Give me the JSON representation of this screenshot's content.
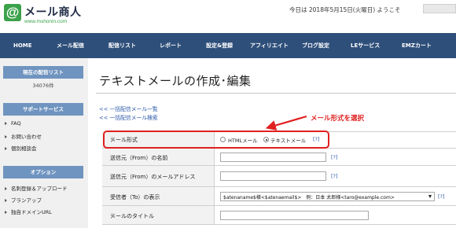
{
  "header": {
    "logo_mark": "@",
    "logo_name": "メール商人",
    "logo_url": "www.mshonin.com",
    "date_text": "今日は 2018年5月15日(火曜日) ようこそ"
  },
  "nav": {
    "items": [
      "HOME",
      "メール配信",
      "配信リスト",
      "レポート",
      "設定&登録",
      "アフィリエイト",
      "ブログ設定",
      "LEサービス",
      "EMZカート"
    ]
  },
  "sidebar": {
    "current_list_title": "現在の配信リスト",
    "current_list_count": "34076件",
    "support_title": "サポートサービス",
    "support_links": [
      "FAQ",
      "お問い合わせ",
      "個別相談会"
    ],
    "options_title": "オプション",
    "options_links": [
      "名刺登録＆アップロード",
      "プランアップ",
      "独自ドメインURL"
    ]
  },
  "main": {
    "title": "テキストメールの作成･編集",
    "links": [
      "<< 一括配信メール一覧",
      "<< 一括配信メール検索"
    ],
    "annotation": "メール形式を選択",
    "required_mark": "※",
    "help_text": "[?]",
    "form": {
      "mail_format": {
        "label": "メール形式",
        "options": [
          "HTMLメール",
          "テキストメール"
        ],
        "selected": "テキストメール"
      },
      "from_name": {
        "label": "送信元（From）の名前",
        "value": ""
      },
      "from_address": {
        "label": "送信元（From）のメールアドレス",
        "value": ""
      },
      "to_display": {
        "label": "受信者（To）の表示",
        "selected": "$atenaname$様<$atenaemail$>　例：日本 太郎様<taro@example.com>"
      },
      "subject": {
        "label": "メールのタイトル",
        "value": ""
      }
    }
  },
  "colors": {
    "nav_bg": "#2e4f7a",
    "sidebar_head_bg": "#6f94bf",
    "logo_green": "#3ba24b",
    "annotation_red": "#e02020",
    "link_blue": "#2a57a8"
  }
}
